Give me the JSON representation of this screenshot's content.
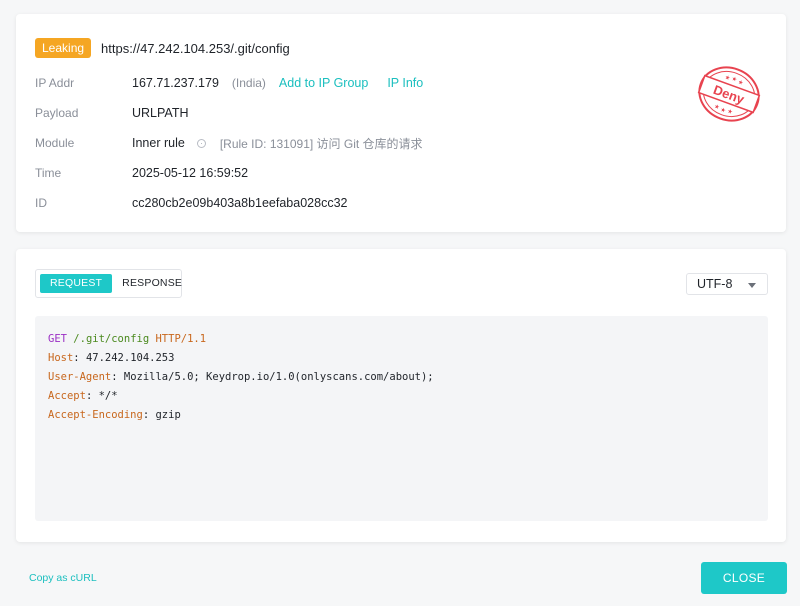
{
  "event": {
    "badge": "Leaking",
    "url": "https://47.242.104.253/.git/config",
    "rows": {
      "ip": {
        "label": "IP Addr",
        "value": "167.71.237.179",
        "country": "(India)",
        "add_link": "Add to IP Group",
        "info_link": "IP Info"
      },
      "payload": {
        "label": "Payload",
        "value": "URLPATH"
      },
      "module": {
        "label": "Module",
        "value": "Inner rule",
        "rule": "[Rule ID: 131091] 访问 Git 仓库的请求"
      },
      "time": {
        "label": "Time",
        "value": "2025-05-12 16:59:52"
      },
      "id": {
        "label": "ID",
        "value": "cc280cb2e09b403a8b1eefaba028cc32"
      }
    },
    "stamp": {
      "text": "Deny",
      "color": "#e8434f"
    }
  },
  "detail": {
    "tabs": {
      "request": "REQUEST",
      "response": "RESPONSE",
      "active": "request"
    },
    "encoding": "UTF-8",
    "request": {
      "method": "GET",
      "path": "/.git/config",
      "protocol": "HTTP/1.1",
      "headers": [
        {
          "name": "Host",
          "value": "47.242.104.253"
        },
        {
          "name": "User-Agent",
          "value": "Mozilla/5.0; Keydrop.io/1.0(onlyscans.com/about);"
        },
        {
          "name": "Accept",
          "value": "*/*"
        },
        {
          "name": "Accept-Encoding",
          "value": "gzip"
        }
      ]
    }
  },
  "footer": {
    "copy_curl": "Copy as cURL",
    "close": "CLOSE"
  },
  "colors": {
    "accent": "#1ec8c8",
    "badge": "#f5a623"
  },
  "icons": {
    "module_info": "info-circle-icon",
    "encoding_caret": "chevron-down-icon"
  }
}
